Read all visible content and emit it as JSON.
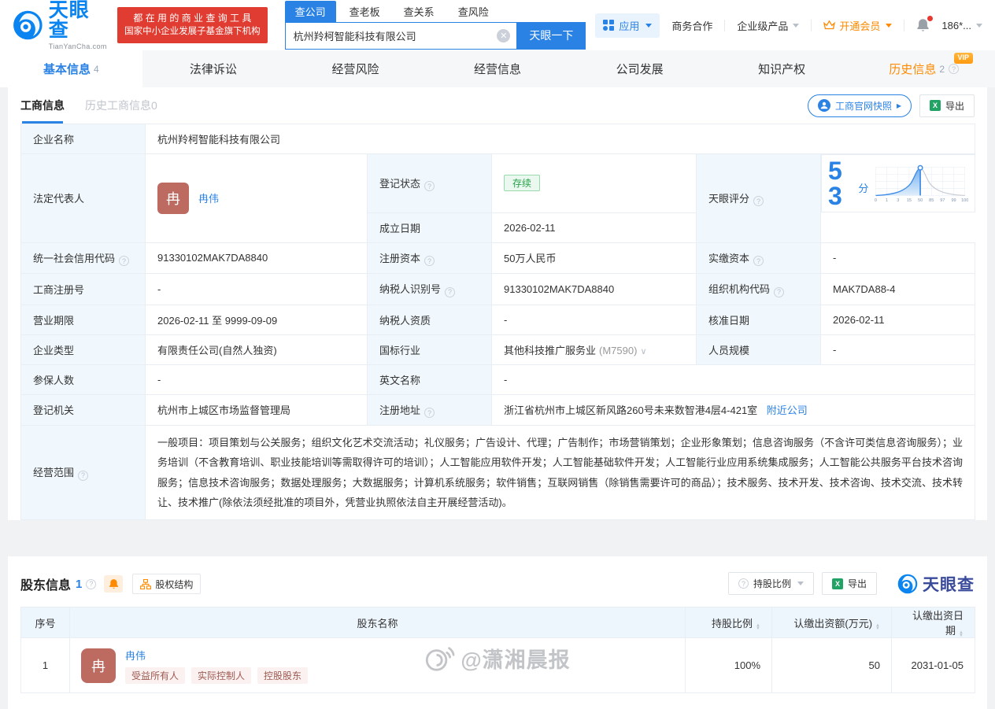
{
  "colors": {
    "brand_blue": "#2a82e4",
    "logo_blue": "#0a84f0",
    "vip_orange": "#ff8a00",
    "promo_red": "#e03c31",
    "status_green": "#28a049"
  },
  "header": {
    "logo_title": "天眼查",
    "logo_subtitle": "TianYanCha.com",
    "promo_line1": "都 在 用 的 商 业 查 询 工 具",
    "promo_line2": "国家中小企业发展子基金旗下机构",
    "search_tabs": [
      {
        "label": "查公司"
      },
      {
        "label": "查老板"
      },
      {
        "label": "查关系"
      },
      {
        "label": "查风险"
      }
    ],
    "search_value": "杭州羚柯智能科技有限公司",
    "search_button": "天眼一下",
    "nav_apps": "应用",
    "nav_cooperation": "商务合作",
    "nav_enterprise": "企业级产品",
    "nav_vip": "开通会员",
    "nav_user": "186*..."
  },
  "tabs": [
    {
      "label": "基本信息",
      "count": "4"
    },
    {
      "label": "法律诉讼"
    },
    {
      "label": "经营风险"
    },
    {
      "label": "经营信息"
    },
    {
      "label": "公司发展"
    },
    {
      "label": "知识产权"
    },
    {
      "label": "历史信息",
      "count": "2",
      "badge": "VIP"
    }
  ],
  "subtabs": {
    "current": "工商信息",
    "history": "历史工商信息0"
  },
  "toolbar": {
    "snapshot": "工商官网快照",
    "export": "导出"
  },
  "company": {
    "name_label": "企业名称",
    "name": "杭州羚柯智能科技有限公司",
    "legal_rep_label": "法定代表人",
    "legal_rep_avatar": "冉",
    "legal_rep_name": "冉伟",
    "reg_status_label": "登记状态",
    "reg_status": "存续",
    "establish_label": "成立日期",
    "establish_date": "2026-02-11",
    "score_label": "天眼评分",
    "score": "53",
    "score_unit": "分"
  },
  "score_chart": {
    "type": "area",
    "title": "天眼评分分布曲线",
    "score": 53,
    "axis_labels": [
      "0",
      "1",
      "3",
      "15",
      "50",
      "85",
      "97",
      "99",
      "100"
    ]
  },
  "info_rows": [
    {
      "cells": [
        {
          "label": "统一社会信用代码",
          "value": "91330102MAK7DA8840"
        },
        {
          "label": "注册资本",
          "value": "50万人民币"
        },
        {
          "label": "实缴资本",
          "value": "-"
        }
      ]
    },
    {
      "cells": [
        {
          "label": "工商注册号",
          "value": "-"
        },
        {
          "label": "纳税人识别号",
          "value": "91330102MAK7DA8840"
        },
        {
          "label": "组织机构代码",
          "value": "MAK7DA88-4"
        }
      ]
    },
    {
      "cells": [
        {
          "label": "营业期限",
          "value": "2026-02-11 至 9999-09-09"
        },
        {
          "label": "纳税人资质",
          "value": "-"
        },
        {
          "label": "核准日期",
          "value": "2026-02-11"
        }
      ]
    },
    {
      "cells": [
        {
          "label": "企业类型",
          "value": "有限责任公司(自然人独资)"
        },
        {
          "label": "国标行业",
          "value": "其他科技推广服务业",
          "code": "(M7590)"
        },
        {
          "label": "人员规模",
          "value": "-"
        }
      ]
    },
    {
      "cells": [
        {
          "label": "参保人数",
          "value": "-"
        },
        {
          "label": "英文名称",
          "value": "-"
        }
      ]
    },
    {
      "cells": [
        {
          "label": "登记机关",
          "value": "杭州市上城区市场监督管理局"
        },
        {
          "label": "注册地址",
          "value": "浙江省杭州市上城区新风路260号未来数智港4层4-421室",
          "link": "附近公司"
        }
      ]
    }
  ],
  "business_scope": {
    "label": "经营范围",
    "text": "一般项目：项目策划与公关服务；组织文化艺术交流活动；礼仪服务；广告设计、代理；广告制作；市场营销策划；企业形象策划；信息咨询服务（不含许可类信息咨询服务）；业务培训（不含教育培训、职业技能培训等需取得许可的培训）；人工智能应用软件开发；人工智能基础软件开发；人工智能行业应用系统集成服务；人工智能公共服务平台技术咨询服务；信息技术咨询服务；数据处理服务；大数据服务；计算机系统服务；软件销售；互联网销售（除销售需要许可的商品）；技术服务、技术开发、技术咨询、技术交流、技术转让、技术推广(除依法须经批准的项目外，凭营业执照依法自主开展经营活动)。"
  },
  "shareholders": {
    "title": "股东信息",
    "count": "1",
    "structure_btn": "股权结构",
    "ratio_btn": "持股比例",
    "export_btn": "导出",
    "brand": "天眼查",
    "columns": [
      "序号",
      "股东名称",
      "持股比例",
      "认缴出资额(万元)",
      "认缴出资日期"
    ],
    "rows": [
      {
        "no": "1",
        "avatar": "冉",
        "name": "冉伟",
        "tags": [
          "受益所有人",
          "实际控制人",
          "控股股东"
        ],
        "ratio": "100%",
        "amount": "50",
        "date": "2031-01-05"
      }
    ]
  },
  "watermark": "@潇湘晨报"
}
